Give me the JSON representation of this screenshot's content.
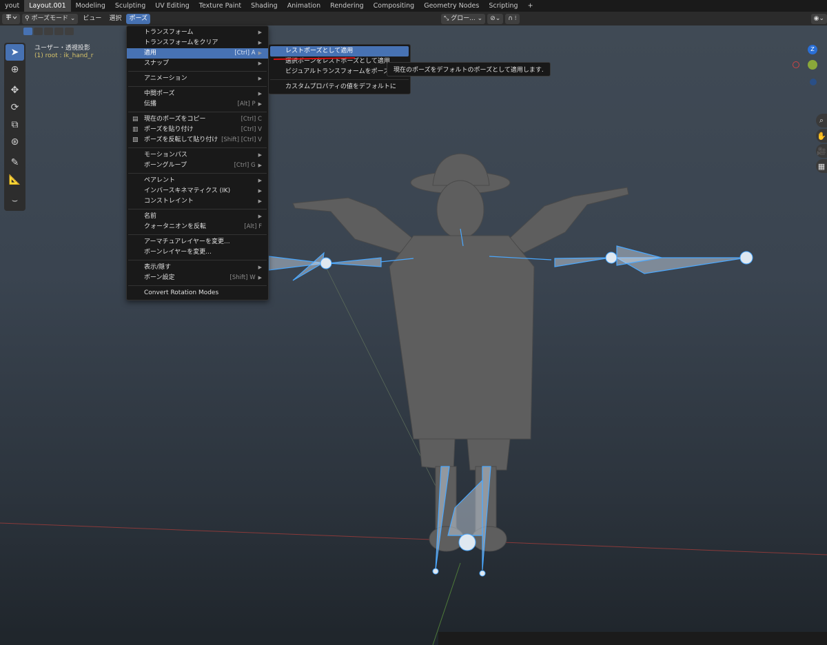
{
  "workspaces": {
    "tabs": [
      "yout",
      "Layout.001",
      "Modeling",
      "Sculpting",
      "UV Editing",
      "Texture Paint",
      "Shading",
      "Animation",
      "Rendering",
      "Compositing",
      "Geometry Nodes",
      "Scripting"
    ],
    "active": "Layout.001",
    "add_label": "+"
  },
  "header": {
    "mode_label": "ポーズモード",
    "view_label": "ビュー",
    "select_label": "選択",
    "pose_label": "ポーズ",
    "orientation_label": "グロー..."
  },
  "viewport": {
    "view_name": "ユーザー・透視投影",
    "active_object": "(1) root : ik_hand_r",
    "gizmo_z": "Z"
  },
  "pose_menu": {
    "items": [
      {
        "label": "トランスフォーム",
        "shortcut": "",
        "submenu": true
      },
      {
        "label": "トランスフォームをクリア",
        "shortcut": "",
        "submenu": true
      },
      {
        "label": "適用",
        "shortcut": "[Ctrl] A",
        "submenu": true
      },
      {
        "label": "スナップ",
        "shortcut": "",
        "submenu": true
      },
      {
        "label": "アニメーション",
        "shortcut": "",
        "submenu": true
      },
      {
        "label": "中間ポーズ",
        "shortcut": "",
        "submenu": true
      },
      {
        "label": "伝播",
        "shortcut": "[Alt] P",
        "submenu": true
      },
      {
        "label": "現在のポーズをコピー",
        "shortcut": "[Ctrl] C",
        "submenu": false
      },
      {
        "label": "ポーズを貼り付け",
        "shortcut": "[Ctrl] V",
        "submenu": false
      },
      {
        "label": "ポーズを反転して貼り付け",
        "shortcut": "[Shift] [Ctrl] V",
        "submenu": false
      },
      {
        "label": "モーションパス",
        "shortcut": "",
        "submenu": true
      },
      {
        "label": "ボーングループ",
        "shortcut": "[Ctrl] G",
        "submenu": true
      },
      {
        "label": "ペアレント",
        "shortcut": "",
        "submenu": true
      },
      {
        "label": "インバースキネマティクス (IK)",
        "shortcut": "",
        "submenu": true
      },
      {
        "label": "コンストレイント",
        "shortcut": "",
        "submenu": true
      },
      {
        "label": "名前",
        "shortcut": "",
        "submenu": true
      },
      {
        "label": "クォータニオンを反転",
        "shortcut": "[Alt] F",
        "submenu": false
      },
      {
        "label": "アーマチュアレイヤーを変更...",
        "shortcut": "",
        "submenu": false
      },
      {
        "label": "ボーンレイヤーを変更...",
        "shortcut": "",
        "submenu": false
      },
      {
        "label": "表示/隠す",
        "shortcut": "",
        "submenu": true
      },
      {
        "label": "ボーン設定",
        "shortcut": "[Shift] W",
        "submenu": true
      },
      {
        "label": "Convert Rotation Modes",
        "shortcut": "",
        "submenu": false
      }
    ],
    "highlighted_index": 2
  },
  "apply_submenu": {
    "items": [
      "レストポーズとして適用",
      "選択ボーンをレストポーズとして適用",
      "ビジュアルトランスフォームをポーズに適用",
      "カスタムプロパティの値をデフォルトに"
    ],
    "highlighted_index": 0
  },
  "tooltip": {
    "text": "現在のポーズをデフォルトのポーズとして適用します."
  },
  "colors": {
    "accent": "#4772b3",
    "annotation_red": "#d41010",
    "bone_blue": "#4aa8ff"
  }
}
